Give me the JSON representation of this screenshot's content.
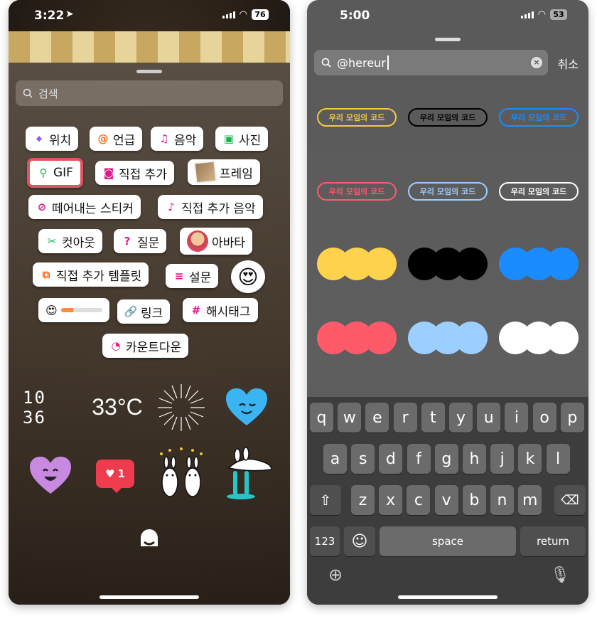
{
  "left_phone": {
    "status": {
      "time": "3:22",
      "battery": "76"
    },
    "search_placeholder": "검색",
    "stickers": {
      "location": "위치",
      "mention": "언급",
      "music": "음악",
      "photo": "사진",
      "gif": "GIF",
      "add_yours": "직접 추가",
      "frame": "프레임",
      "cutout": "떼어내는 스티커",
      "add_yours_music": "직접 추가 음악",
      "cutout2": "컷아웃",
      "question": "질문",
      "avatar": "아바타",
      "add_yours_template": "직접 추가 템플릿",
      "poll": "설문",
      "link": "링크",
      "hashtag": "해시태그",
      "countdown": "카운트다운"
    },
    "clock": "10 36",
    "temperature": "33°C",
    "like_count": "1"
  },
  "right_phone": {
    "status": {
      "time": "5:00",
      "battery": "53"
    },
    "search_value": "@hereur",
    "cancel": "취소",
    "code_pills": [
      {
        "label": "우리 모임의 코드",
        "color": "#f5c842",
        "fill": "transparent",
        "text": "#f5c842"
      },
      {
        "label": "우리 모임의 코드",
        "color": "#000000",
        "fill": "transparent",
        "text": "#000000"
      },
      {
        "label": "우리 모임의 코드",
        "color": "#1a8cff",
        "fill": "transparent",
        "text": "#1a8cff"
      },
      {
        "label": "우리 모임의 코드",
        "color": "#ff5a6a",
        "fill": "transparent",
        "text": "#ff5a6a"
      },
      {
        "label": "우리 모임의 코드",
        "color": "#9ccfff",
        "fill": "transparent",
        "text": "#9ccfff"
      },
      {
        "label": "우리 모임의 코드",
        "color": "#ffffff",
        "fill": "transparent",
        "text": "#ffffff"
      }
    ],
    "dot_colors": [
      "#ffd24d",
      "#000000",
      "#1a8cff",
      "#ff5a6a",
      "#9ccfff",
      "#ffffff"
    ],
    "keyboard": {
      "row1": [
        "q",
        "w",
        "e",
        "r",
        "t",
        "y",
        "u",
        "i",
        "o",
        "p"
      ],
      "row2": [
        "a",
        "s",
        "d",
        "f",
        "g",
        "h",
        "j",
        "k",
        "l"
      ],
      "row3": [
        "z",
        "x",
        "c",
        "v",
        "b",
        "n",
        "m"
      ],
      "numbers": "123",
      "space": "space",
      "return": "return"
    }
  }
}
